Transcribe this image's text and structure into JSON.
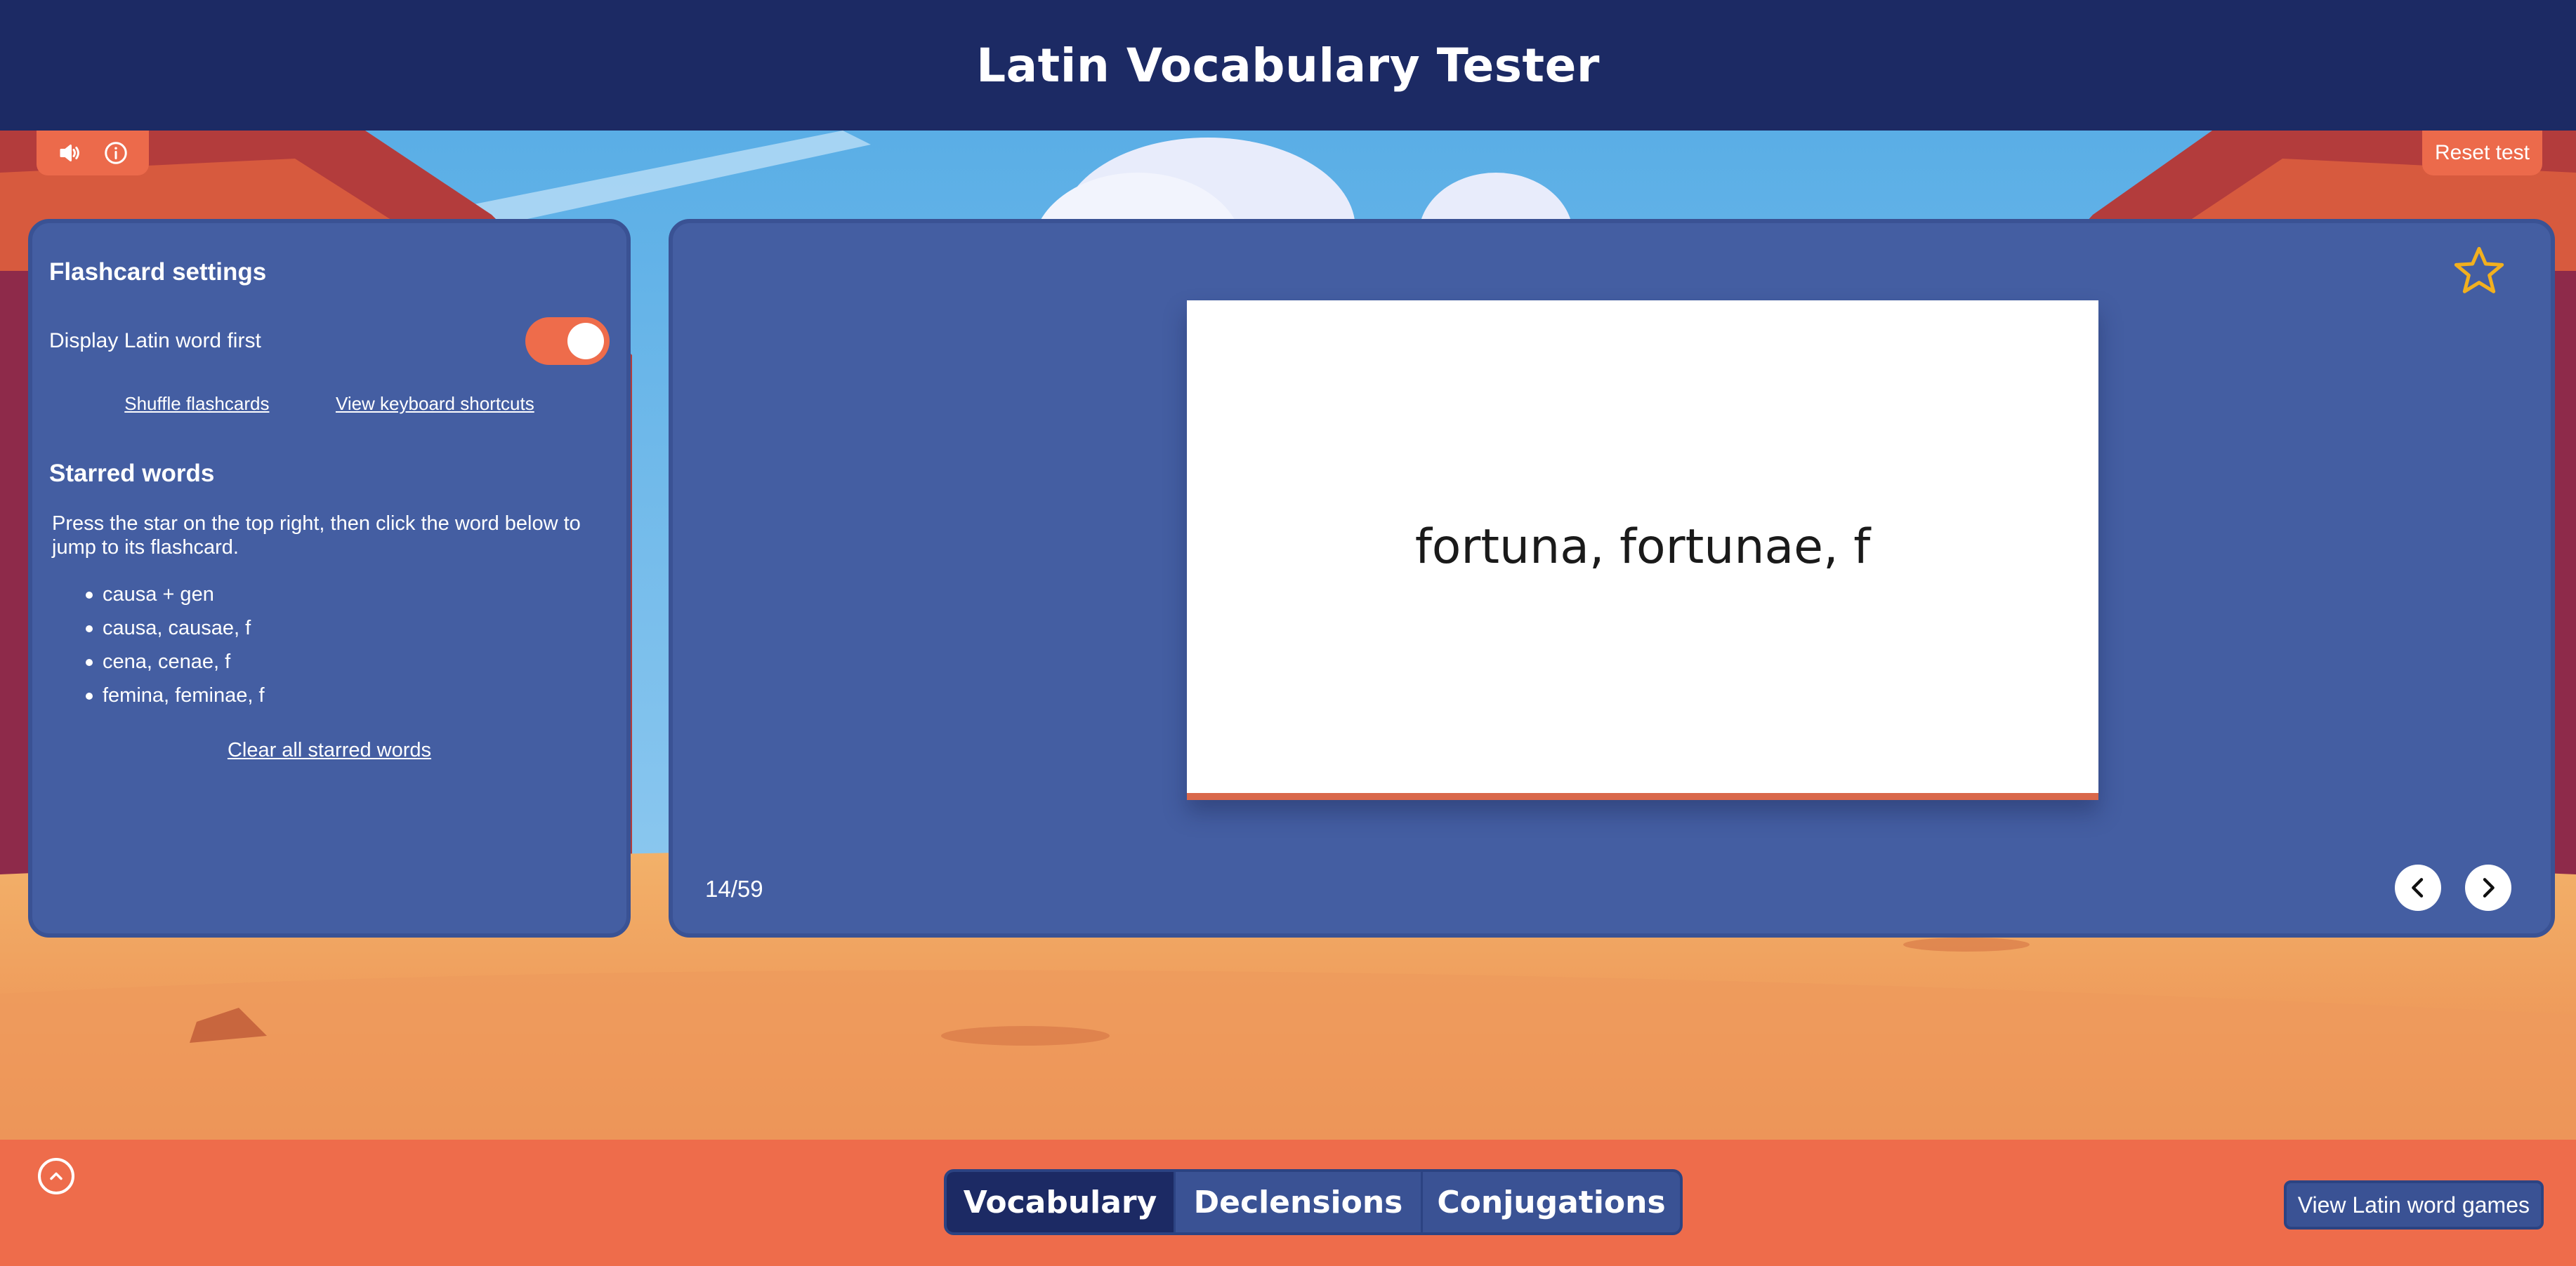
{
  "app": {
    "title": "Latin Vocabulary Tester"
  },
  "top_controls": {
    "sound_icon": "speaker-icon",
    "info_icon": "info-icon",
    "reset_label": "Reset test"
  },
  "settings": {
    "heading": "Flashcard settings",
    "toggle_label": "Display Latin word first",
    "toggle_on": true,
    "shuffle_label": "Shuffle flashcards",
    "shortcuts_label": "View keyboard shortcuts"
  },
  "starred": {
    "heading": "Starred words",
    "description": "Press the star on the top right, then click the word below to jump to its flashcard.",
    "items": [
      "causa + gen",
      "causa, causae, f",
      "cena, cenae, f",
      "femina, feminae, f"
    ],
    "clear_label": "Clear all starred words"
  },
  "flashcard": {
    "word": "fortuna, fortunae, f",
    "counter": "14/59",
    "star_icon": "star-outline-icon"
  },
  "tabs": [
    {
      "label": "Vocabulary",
      "active": true
    },
    {
      "label": "Declensions",
      "active": false
    },
    {
      "label": "Conjugations",
      "active": false
    }
  ],
  "footer": {
    "games_label": "View Latin word games"
  },
  "colors": {
    "header_bg": "#1c2a64",
    "panel_bg": "#445ea2",
    "accent": "#ee6c4b",
    "star": "#f2b01e"
  }
}
